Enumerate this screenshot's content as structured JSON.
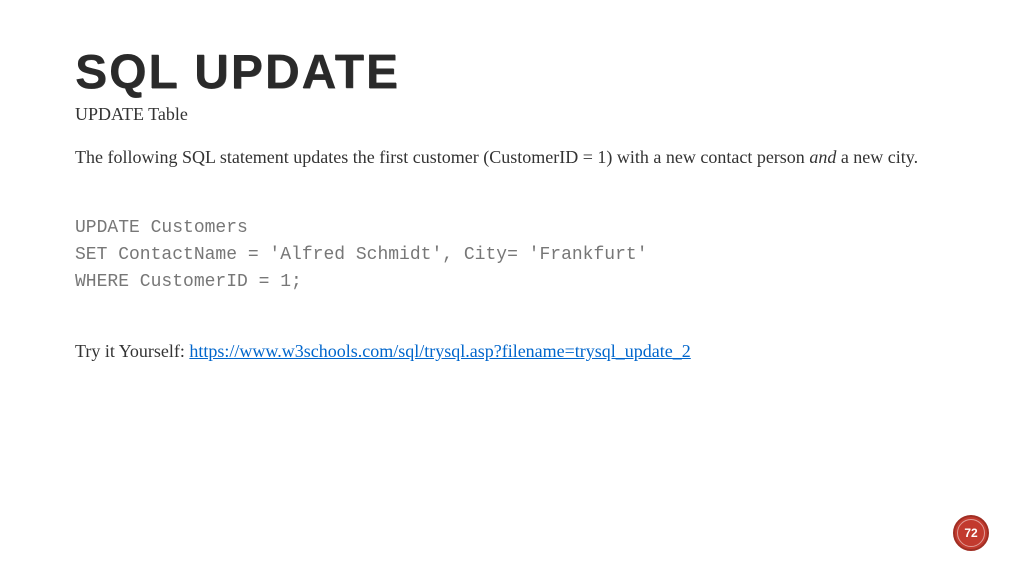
{
  "title": "SQL UPDATE",
  "subtitle": "UPDATE Table",
  "description_part1": "The following SQL statement updates the first customer (CustomerID = 1) with a new contact person ",
  "description_italic": "and",
  "description_part2": " a new city.",
  "code": "UPDATE Customers\nSET ContactName = 'Alfred Schmidt', City= 'Frankfurt'\nWHERE CustomerID = 1;",
  "try_label": "Try it Yourself: ",
  "try_url": "https://www.w3schools.com/sql/trysql.asp?filename=trysql_update_2",
  "page_number": "72"
}
